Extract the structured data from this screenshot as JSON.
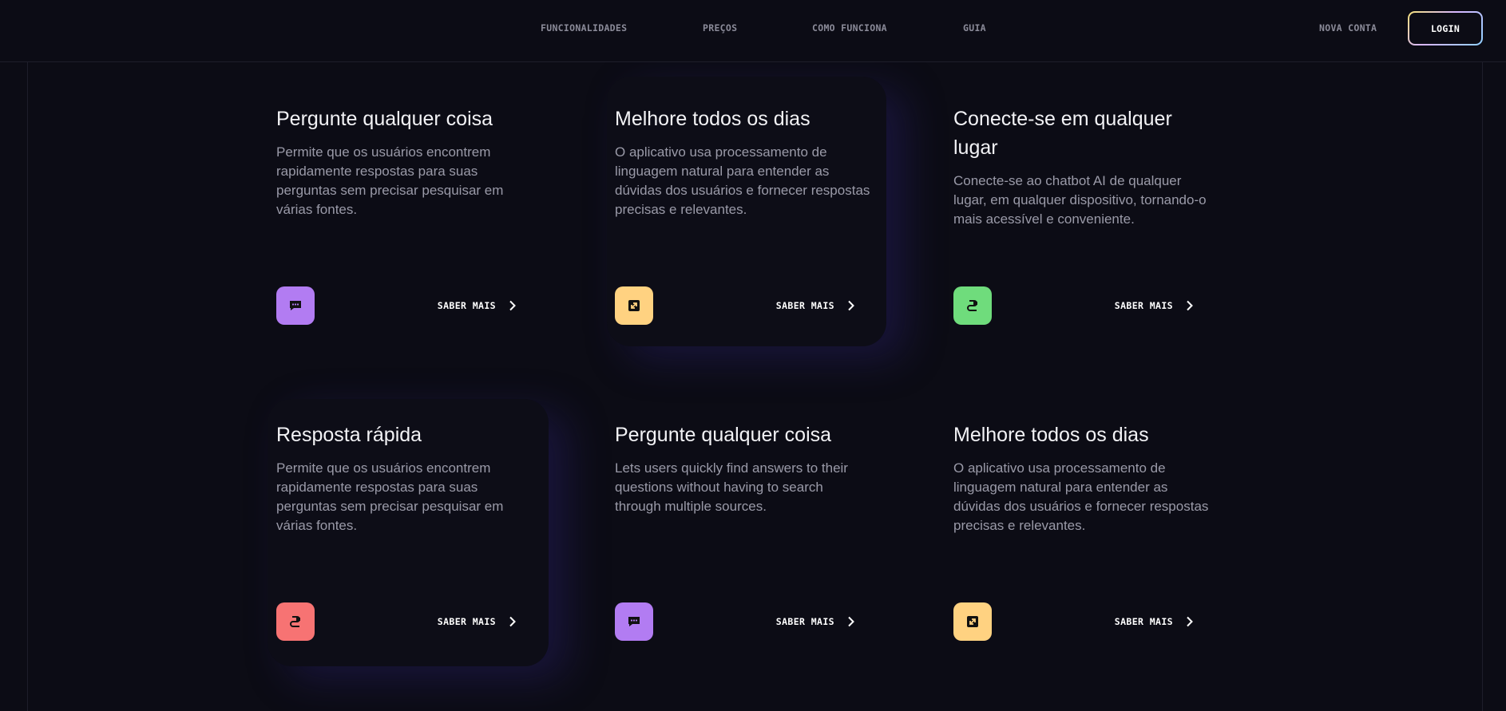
{
  "nav": {
    "links": [
      "FUNCIONALIDADES",
      "PREÇOS",
      "COMO FUNCIONA",
      "GUIA"
    ],
    "account": "NOVA CONTA",
    "login": "LOGIN"
  },
  "colors": {
    "purple": "#b27cf2",
    "yellow": "#ffd281",
    "green": "#6fdc7c",
    "red": "#f77373",
    "background": "#0c0c15"
  },
  "cards": [
    {
      "title": "Pergunte qualquer coisa",
      "description": "Permite que os usuários encontrem rapidamente respostas para suas perguntas sem precisar pesquisar em várias fontes.",
      "icon": "chat-icon",
      "link": "SABER MAIS"
    },
    {
      "title": "Melhore todos os dias",
      "description": "O aplicativo usa processamento de linguagem natural para entender as dúvidas dos usuários e fornecer respostas precisas e relevantes.",
      "icon": "expand-icon",
      "link": "SABER MAIS"
    },
    {
      "title": "Conecte-se em qualquer lugar",
      "description": "Conecte-se ao chatbot AI de qualquer lugar, em qualquer dispositivo, tornando-o mais acessível e conveniente.",
      "icon": "plug-icon",
      "link": "SABER MAIS"
    },
    {
      "title": "Resposta rápida",
      "description": "Permite que os usuários encontrem rapidamente respostas para suas perguntas sem precisar pesquisar em várias fontes.",
      "icon": "plug-icon",
      "link": "SABER MAIS"
    },
    {
      "title": "Pergunte qualquer coisa",
      "description": "Lets users quickly find answers to their questions without having to search through multiple sources.",
      "icon": "chat-icon",
      "link": "SABER MAIS"
    },
    {
      "title": "Melhore todos os dias",
      "description": "O aplicativo usa processamento de linguagem natural para entender as dúvidas dos usuários e fornecer respostas precisas e relevantes.",
      "icon": "expand-icon",
      "link": "SABER MAIS"
    }
  ]
}
